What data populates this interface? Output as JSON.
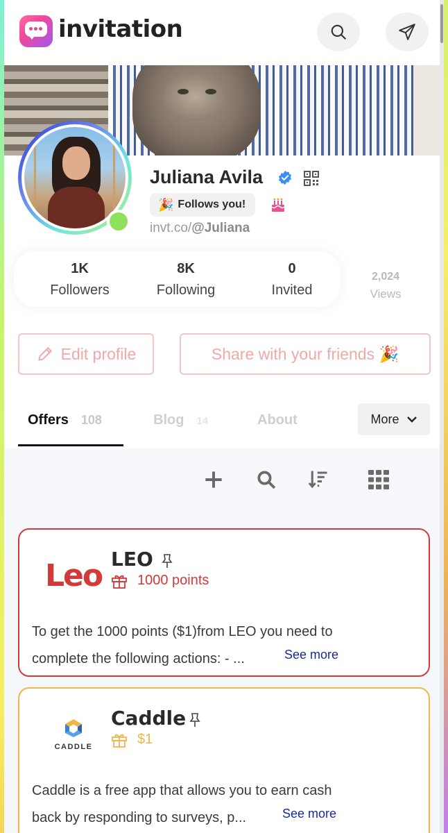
{
  "header": {
    "brand": "invitation",
    "search_icon": "search-icon",
    "send_icon": "send-icon"
  },
  "profile": {
    "name": "Juliana Avila",
    "follows_badge": "Follows you!",
    "follows_emoji": "🎉",
    "handle_prefix": "invt.co/",
    "handle": "@Juliana",
    "online": true
  },
  "stats": [
    {
      "value": "1K",
      "label": "Followers"
    },
    {
      "value": "8K",
      "label": "Following"
    },
    {
      "value": "0",
      "label": "Invited"
    }
  ],
  "views": {
    "value": "2,024",
    "label": "Views"
  },
  "actions": {
    "edit_profile": "Edit profile",
    "share": "Share with your friends 🎉"
  },
  "tabs": [
    {
      "label": "Offers",
      "count": "108",
      "active": true
    },
    {
      "label": "Blog",
      "count": "14",
      "active": false
    },
    {
      "label": "About",
      "count": "",
      "active": false
    }
  ],
  "more_label": "More",
  "offers": [
    {
      "logo_text": "Leo",
      "title": "LEO",
      "reward": "1000 points",
      "description": "To get the 1000 points ($1)from LEO you need to complete the following actions: - ...",
      "see_more": "See more",
      "accent": "#d23a3a"
    },
    {
      "logo_text": "CADDLE",
      "title": "Caddle",
      "reward": "$1",
      "description": "Caddle is a free app that allows you to earn cash back by responding to surveys, p...",
      "see_more": "See more",
      "accent": "#f0b64a"
    }
  ],
  "colors": {
    "leo_red": "#d23a3a",
    "caddle_gold": "#f0b64a",
    "link_blue": "#1a2a9a",
    "outline_pink": "#f3c6c6"
  }
}
